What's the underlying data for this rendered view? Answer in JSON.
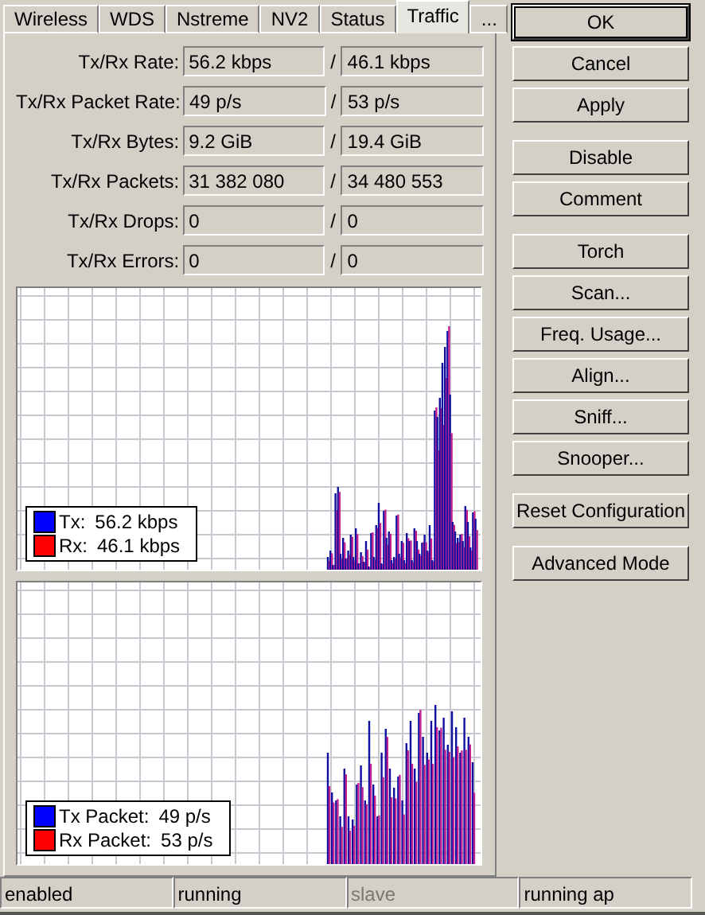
{
  "tabs": [
    {
      "label": "Wireless",
      "selected": false
    },
    {
      "label": "WDS",
      "selected": false
    },
    {
      "label": "Nstreme",
      "selected": false
    },
    {
      "label": "NV2",
      "selected": false
    },
    {
      "label": "Status",
      "selected": false
    },
    {
      "label": "Traffic",
      "selected": true
    },
    {
      "label": "...",
      "selected": false
    }
  ],
  "stats": [
    {
      "label": "Tx/Rx Rate:",
      "tx": "56.2 kbps",
      "separator": "/",
      "rx": "46.1 kbps"
    },
    {
      "label": "Tx/Rx Packet Rate:",
      "tx": "49 p/s",
      "separator": "/",
      "rx": "53 p/s"
    },
    {
      "label": "Tx/Rx Bytes:",
      "tx": "9.2 GiB",
      "separator": "/",
      "rx": "19.4 GiB"
    },
    {
      "label": "Tx/Rx Packets:",
      "tx": "31 382 080",
      "separator": "/",
      "rx": "34 480 553"
    },
    {
      "label": "Tx/Rx Drops:",
      "tx": "0",
      "separator": "/",
      "rx": "0"
    },
    {
      "label": "Tx/Rx Errors:",
      "tx": "0",
      "separator": "/",
      "rx": "0"
    }
  ],
  "graphs": [
    {
      "legend": [
        {
          "label": "Tx:",
          "value": "56.2 kbps",
          "color": "#0000ff"
        },
        {
          "label": "Rx:",
          "value": "46.1 kbps",
          "color": "#ff0000"
        }
      ]
    },
    {
      "legend": [
        {
          "label": "Tx Packet:",
          "value": "49 p/s",
          "color": "#0000ff"
        },
        {
          "label": "Rx Packet:",
          "value": "53 p/s",
          "color": "#ff0000"
        }
      ]
    }
  ],
  "button_groups": [
    [
      {
        "label": "OK",
        "default": true
      },
      {
        "label": "Cancel",
        "default": false
      },
      {
        "label": "Apply",
        "default": false
      }
    ],
    [
      {
        "label": "Disable",
        "default": false
      },
      {
        "label": "Comment",
        "default": false
      }
    ],
    [
      {
        "label": "Torch",
        "default": false
      },
      {
        "label": "Scan...",
        "default": false
      },
      {
        "label": "Freq. Usage...",
        "default": false
      },
      {
        "label": "Align...",
        "default": false
      },
      {
        "label": "Sniff...",
        "default": false
      },
      {
        "label": "Snooper...",
        "default": false
      }
    ],
    [
      {
        "label": "Reset Configuration",
        "default": false
      }
    ],
    [
      {
        "label": "Advanced Mode",
        "default": false
      }
    ]
  ],
  "status_bar": [
    {
      "text": "enabled",
      "disabled": false
    },
    {
      "text": "running",
      "disabled": false
    },
    {
      "text": "slave",
      "disabled": true
    },
    {
      "text": "running ap",
      "disabled": false
    }
  ]
}
